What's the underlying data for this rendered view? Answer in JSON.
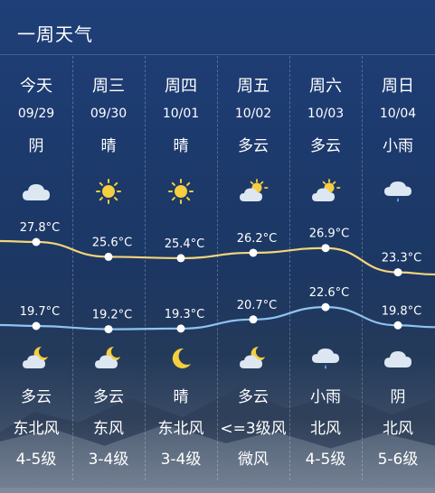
{
  "header": {
    "title": "一周天气"
  },
  "days": [
    {
      "day": "今天",
      "date": "09/29",
      "cond": "阴",
      "day_icon": "cloudy-icon",
      "high": "27.8°C",
      "low": "19.7°C",
      "night_icon": "partly-cloudy-night-icon",
      "night_cond": "多云",
      "wind_dir": "东北风",
      "wind_level": "4-5级"
    },
    {
      "day": "周三",
      "date": "09/30",
      "cond": "晴",
      "day_icon": "sunny-icon",
      "high": "25.6°C",
      "low": "19.2°C",
      "night_icon": "partly-cloudy-night-icon",
      "night_cond": "多云",
      "wind_dir": "东风",
      "wind_level": "3-4级"
    },
    {
      "day": "周四",
      "date": "10/01",
      "cond": "晴",
      "day_icon": "sunny-icon",
      "high": "25.4°C",
      "low": "19.3°C",
      "night_icon": "moon-icon",
      "night_cond": "晴",
      "wind_dir": "东北风",
      "wind_level": "3-4级"
    },
    {
      "day": "周五",
      "date": "10/02",
      "cond": "多云",
      "day_icon": "partly-cloudy-icon",
      "high": "26.2°C",
      "low": "20.7°C",
      "night_icon": "partly-cloudy-night-icon",
      "night_cond": "多云",
      "wind_dir": "<=3级风",
      "wind_level": "微风"
    },
    {
      "day": "周六",
      "date": "10/03",
      "cond": "多云",
      "day_icon": "partly-cloudy-icon",
      "high": "26.9°C",
      "low": "22.6°C",
      "night_icon": "light-rain-icon",
      "night_cond": "小雨",
      "wind_dir": "北风",
      "wind_level": "4-5级"
    },
    {
      "day": "周日",
      "date": "10/04",
      "cond": "小雨",
      "day_icon": "light-rain-icon",
      "high": "23.3°C",
      "low": "19.8°C",
      "night_icon": "cloudy-icon",
      "night_cond": "阴",
      "wind_dir": "北风",
      "wind_level": "5-6级"
    }
  ],
  "chart_data": {
    "type": "line",
    "categories": [
      "今天",
      "周三",
      "周四",
      "周五",
      "周六",
      "周日"
    ],
    "series": [
      {
        "values": [
          27.8,
          25.6,
          25.4,
          26.2,
          26.9,
          23.3
        ]
      },
      {
        "values": [
          19.7,
          19.2,
          19.3,
          20.7,
          22.6,
          19.8
        ]
      }
    ],
    "colors": {
      "high": "#f4d57a",
      "low": "#8fc4f2"
    }
  }
}
